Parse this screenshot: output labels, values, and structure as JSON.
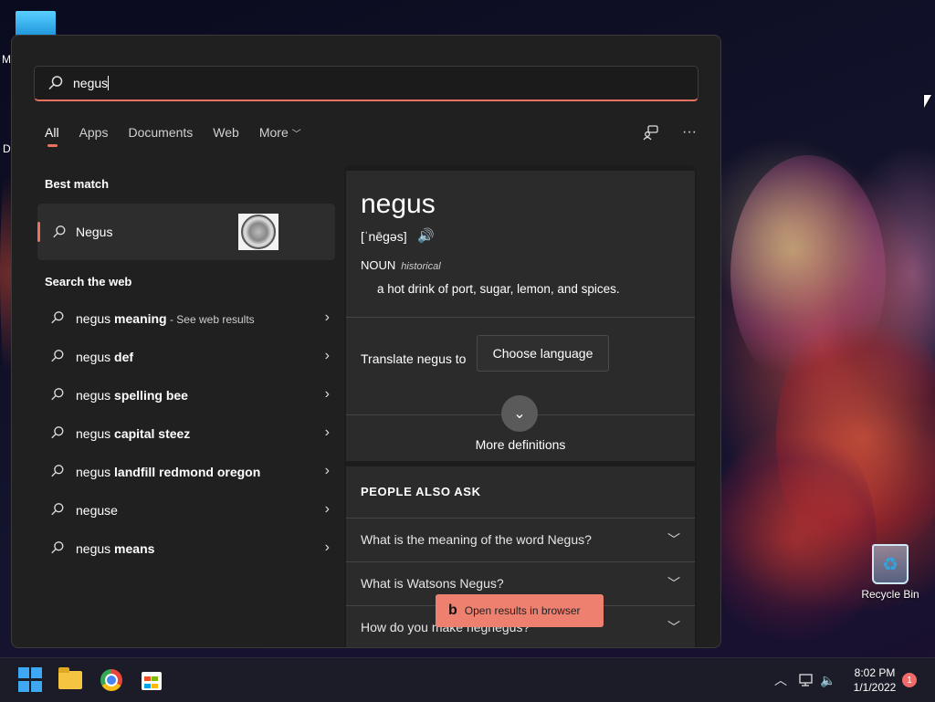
{
  "desktop": {
    "edge_letter_1": "M",
    "edge_letter_2": "D",
    "recycle_bin_label": "Recycle Bin"
  },
  "search": {
    "query": "negus",
    "icon": "search-icon"
  },
  "tabs": [
    {
      "label": "All",
      "active": true
    },
    {
      "label": "Apps"
    },
    {
      "label": "Documents"
    },
    {
      "label": "Web"
    },
    {
      "label": "More"
    }
  ],
  "tools": {
    "icon_1": "feedback-icon",
    "icon_2": "more-options-icon"
  },
  "best_match": {
    "title": "Best match",
    "item_label": "Negus"
  },
  "web": {
    "title": "Search the web",
    "items": [
      {
        "prefix": "negus",
        "bold": " meaning",
        "sub": " - See web results"
      },
      {
        "prefix": "negus",
        "bold": " def",
        "sub": ""
      },
      {
        "prefix": "negus",
        "bold": " spelling bee",
        "sub": ""
      },
      {
        "prefix": "negus",
        "bold": " capital steez",
        "sub": ""
      },
      {
        "prefix": "negus",
        "bold": " landfill redmond oregon",
        "sub": ""
      },
      {
        "prefix": "neguse",
        "bold": "",
        "sub": ""
      },
      {
        "prefix": "negus",
        "bold": " means",
        "sub": ""
      }
    ]
  },
  "preview": {
    "word": "negus",
    "phonetic": "[ˈnēɡəs]",
    "part_of_speech": "NOUN",
    "usage": "historical",
    "definition": "a hot drink of port, sugar, lemon, and spices.",
    "translate_label": "Translate negus to",
    "language_button": "Choose language",
    "more_definitions": "More definitions",
    "people_also_ask": "PEOPLE ALSO ASK",
    "questions": [
      "What is the meaning of the word Negus?",
      "What is Watsons Negus?",
      "How do you make negnegus?"
    ],
    "open_browser": "Open results in browser"
  },
  "taskbar": {
    "time": "8:02 PM",
    "date": "1/1/2022",
    "notifications": "1"
  }
}
